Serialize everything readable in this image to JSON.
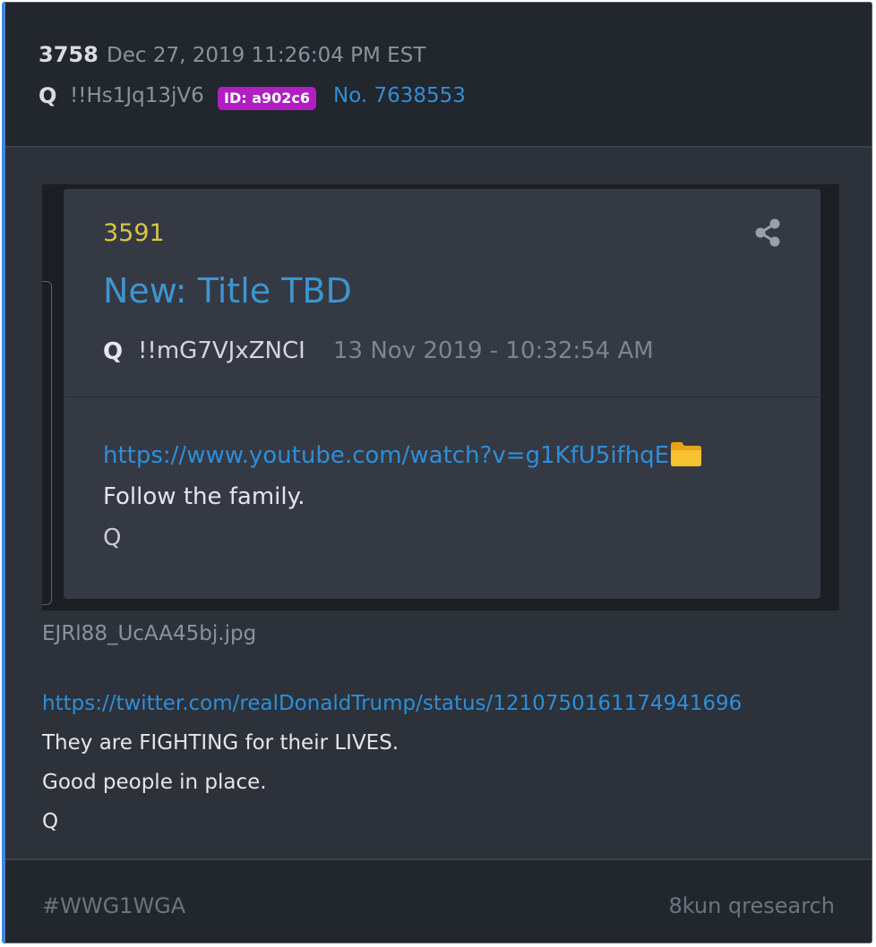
{
  "post": {
    "number": "3758",
    "date": "Dec 27, 2019 11:26:04 PM EST",
    "author": "Q",
    "tripcode": "!!Hs1Jq13jV6",
    "id_badge": "ID: a902c6",
    "post_no": "No. 7638553"
  },
  "quote": {
    "number": "3591",
    "title": "New: Title TBD",
    "author": "Q",
    "tripcode": "!!mG7VJxZNCI",
    "date": "13 Nov 2019 - 10:32:54 AM",
    "link": "https://www.youtube.com/watch?v=g1KfU5ifhqE",
    "lines": [
      "Follow the family.",
      "Q"
    ],
    "icons": {
      "share": "share-icon",
      "folder": "folder-icon"
    }
  },
  "attachment": {
    "filename": "EJRl88_UcAA45bj.jpg"
  },
  "body": {
    "link": "https://twitter.com/realDonaldTrump/status/1210750161174941696",
    "lines": [
      "They are FIGHTING for their LIVES.",
      "Good people in place.",
      "Q"
    ]
  },
  "footer": {
    "hashtag": "#WWG1WGA",
    "source": "8kun qresearch"
  },
  "colors": {
    "accent_border": "#3f88d8",
    "link": "#2d8fd8",
    "id_badge": "#b11fc4",
    "quote_number": "#d5c845",
    "card_bg": "#2c313a",
    "header_bg": "#22262d"
  }
}
